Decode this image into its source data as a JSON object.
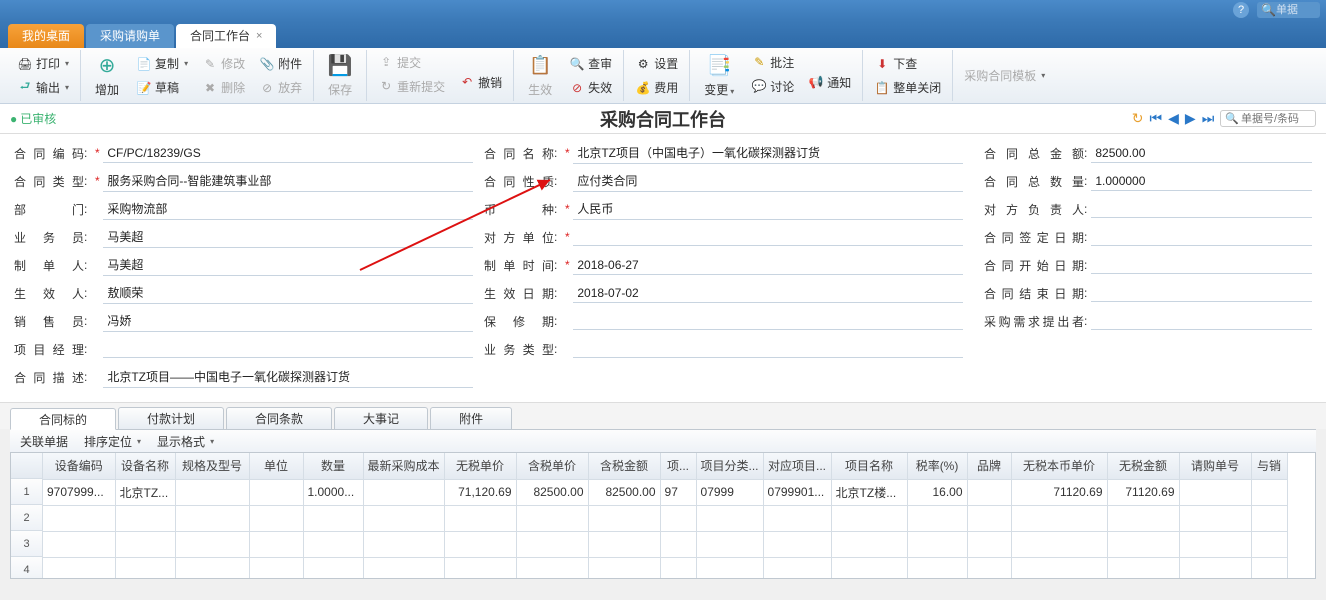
{
  "topbar": {
    "search_placeholder": "单据"
  },
  "tabs": {
    "home": "我的桌面",
    "t1": "采购请购单",
    "t2": "合同工作台"
  },
  "toolbar": {
    "print": "打印",
    "output": "输出",
    "add": "增加",
    "copy": "复制",
    "draft": "草稿",
    "edit": "修改",
    "delete": "删除",
    "attach": "附件",
    "abandon": "放弃",
    "save": "保存",
    "submit": "提交",
    "resubmit": "重新提交",
    "revoke": "撤销",
    "effect": "生效",
    "review": "查审",
    "invalid": "失效",
    "setting": "设置",
    "fee": "费用",
    "change": "变更",
    "note": "批注",
    "discuss": "讨论",
    "notify": "通知",
    "down": "下查",
    "close_all": "整单关闭",
    "template": "采购合同模板"
  },
  "page": {
    "status": "已审核",
    "title": "采购合同工作台",
    "search_placeholder": "单据号/条码"
  },
  "form": {
    "code_lbl": "合同编码",
    "code": "CF/PC/18239/GS",
    "type_lbl": "合同类型",
    "type": "服务采购合同--智能建筑事业部",
    "dept_lbl": "部　　门",
    "dept": "采购物流部",
    "clerk_lbl": "业 务 员",
    "clerk": "马美超",
    "creator_lbl": "制 单 人",
    "creator": "马美超",
    "eff_person_lbl": "生 效 人",
    "eff_person": "敖顺荣",
    "seller_lbl": "销 售 员",
    "seller": "冯娇",
    "pm_lbl": "项目经理",
    "pm": "",
    "desc_lbl": "合同描述",
    "desc": "北京TZ项目——中国电子一氧化碳探测器订货",
    "name_lbl": "合同名称",
    "name": "北京TZ项目（中国电子）一氧化碳探测器订货",
    "nature_lbl": "合同性质",
    "nature": "应付类合同",
    "currency_lbl": "币　　种",
    "currency": "人民币",
    "party_lbl": "对方单位",
    "party": "",
    "make_date_lbl": "制单时间",
    "make_date": "2018-06-27",
    "eff_date_lbl": "生效日期",
    "eff_date": "2018-07-02",
    "warranty_lbl": "保 修 期",
    "warranty": "",
    "biz_type_lbl": "业务类型",
    "biz_type": "",
    "total_lbl": "合同总金额",
    "total": "82500.00",
    "qty_lbl": "合同总数量",
    "qty": "1.000000",
    "contact_lbl": "对方负责人",
    "contact": "",
    "sign_date_lbl": "合同签定日期",
    "sign_date": "",
    "start_date_lbl": "合同开始日期",
    "start_date": "",
    "end_date_lbl": "合同结束日期",
    "end_date": "",
    "demander_lbl": "采购需求提出者",
    "demander": ""
  },
  "dtabs": {
    "t0": "合同标的",
    "t1": "付款计划",
    "t2": "合同条款",
    "t3": "大事记",
    "t4": "附件"
  },
  "gridtools": {
    "link": "关联单据",
    "sort": "排序定位",
    "fmt": "显示格式"
  },
  "cols": {
    "c0": "设备编码",
    "c1": "设备名称",
    "c2": "规格及型号",
    "c3": "单位",
    "c4": "数量",
    "c5": "最新采购成本",
    "c6": "无税单价",
    "c7": "含税单价",
    "c8": "含税金额",
    "c9": "项...",
    "c10": "项目分类...",
    "c11": "对应项目...",
    "c12": "项目名称",
    "c13": "税率(%)",
    "c14": "品牌",
    "c15": "无税本币单价",
    "c16": "无税金额",
    "c17": "请购单号",
    "c18": "与销"
  },
  "row1": {
    "c0": "9707999...",
    "c1": "北京TZ...",
    "c2": "",
    "c3": "",
    "c4": "1.0000...",
    "c5": "",
    "c6": "71,120.69",
    "c7": "82500.00",
    "c8": "82500.00",
    "c9": "97",
    "c10": "07999",
    "c11": "0799901...",
    "c12": "北京TZ楼...",
    "c13": "16.00",
    "c14": "",
    "c15": "71120.69",
    "c16": "71120.69",
    "c17": "",
    "c18": ""
  }
}
